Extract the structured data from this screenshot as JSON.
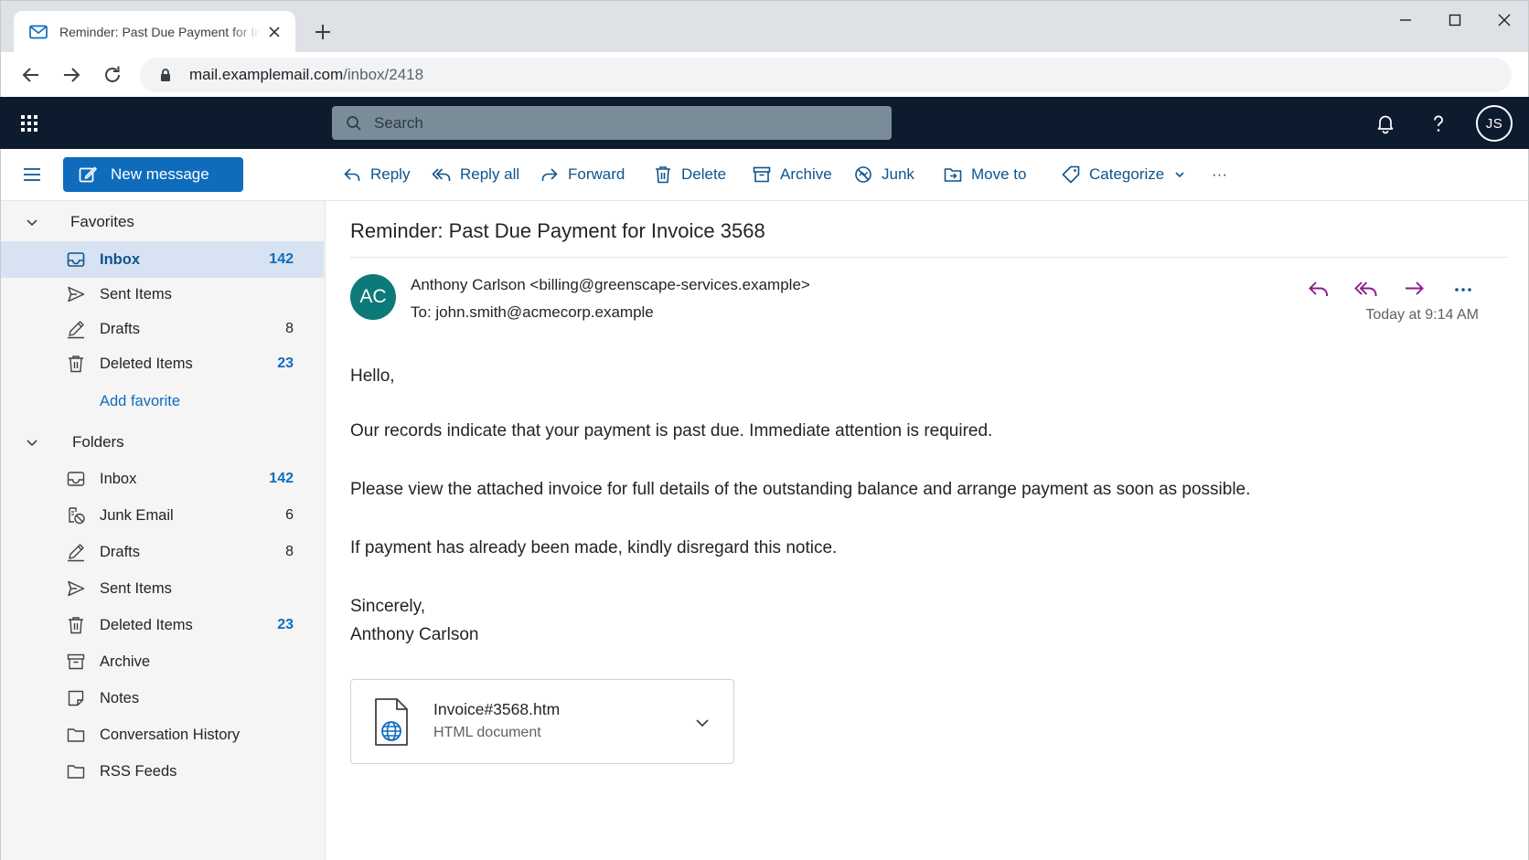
{
  "browser": {
    "tab_title": "Reminder: Past Due Payment for Invoice 3568",
    "url_host": "mail.examplemail.com",
    "url_path": "/inbox/2418"
  },
  "header": {
    "search_placeholder": "Search",
    "user_initials": "JS"
  },
  "toolbar": {
    "new_message": "New message",
    "reply": "Reply",
    "reply_all": "Reply all",
    "forward": "Forward",
    "delete": "Delete",
    "archive": "Archive",
    "junk": "Junk",
    "move_to": "Move to",
    "categorize": "Categorize",
    "more": "···"
  },
  "sidebar": {
    "favorites_label": "Favorites",
    "favorites": [
      {
        "label": "Inbox",
        "count": "142",
        "icon": "inbox-icon"
      },
      {
        "label": "Sent Items",
        "count": "",
        "icon": "send-icon"
      },
      {
        "label": "Drafts",
        "count": "8",
        "icon": "pencil-icon"
      },
      {
        "label": "Deleted Items",
        "count": "23",
        "icon": "trash-icon"
      }
    ],
    "add_favorite": "Add favorite",
    "folders_label": "Folders",
    "folders": [
      {
        "label": "Inbox",
        "count": "142",
        "icon": "inbox-icon"
      },
      {
        "label": "Junk Email",
        "count": "6",
        "icon": "junk-icon"
      },
      {
        "label": "Drafts",
        "count": "8",
        "icon": "pencil-icon"
      },
      {
        "label": "Sent Items",
        "count": "",
        "icon": "send-icon"
      },
      {
        "label": "Deleted Items",
        "count": "23",
        "icon": "trash-icon"
      },
      {
        "label": "Archive",
        "count": "",
        "icon": "archive-icon"
      },
      {
        "label": "Notes",
        "count": "",
        "icon": "note-icon"
      },
      {
        "label": "Conversation History",
        "count": "",
        "icon": "folder-icon"
      },
      {
        "label": "RSS Feeds",
        "count": "",
        "icon": "folder-icon"
      }
    ]
  },
  "message": {
    "subject": "Reminder: Past Due Payment for Invoice 3568",
    "sender_initials": "AC",
    "sender": "Anthony Carlson <billing@greenscape-services.example>",
    "to": "To: john.smith@acmecorp.example",
    "timestamp": "Today at 9:14 AM",
    "body": [
      "Hello,",
      "Our records indicate that your payment is past due. Immediate attention is required.",
      "Please view the attached invoice for full details of the outstanding balance and arrange payment as soon as possible.",
      "If payment has already been made, kindly disregard this notice.",
      "Sincerely,",
      "Anthony Carlson"
    ],
    "attachment": {
      "name": "Invoice#3568.htm",
      "type": "HTML document"
    }
  },
  "colors": {
    "app_header": "#0d1b2e",
    "accent": "#0f6cbd",
    "reply_actions": "#8a1a8f",
    "sender_avatar": "#0d7a7a",
    "selected_nav": "#d7e3f2"
  }
}
